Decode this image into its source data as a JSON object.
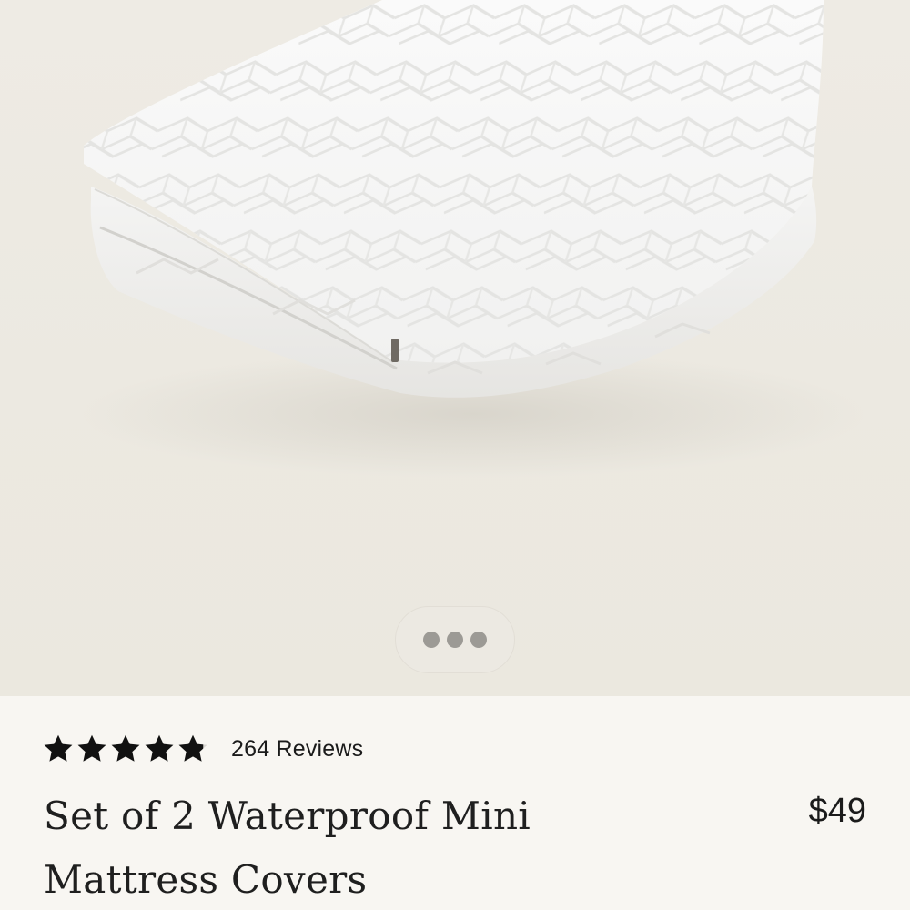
{
  "product": {
    "image_alt": "Folded white quilted waterproof mattress cover",
    "carousel": {
      "dot_count": 3
    },
    "rating": {
      "stars": 4.8,
      "max_stars": 5,
      "reviews_label": "264 Reviews"
    },
    "title": "Set of 2 Waterproof Mini Mattress Covers",
    "price": "$49"
  },
  "colors": {
    "background": "#f8f6f2",
    "hero": "#ece9e1",
    "text": "#1f1f1f",
    "carousel_dot": "#9c9a95",
    "star": "#111111"
  }
}
